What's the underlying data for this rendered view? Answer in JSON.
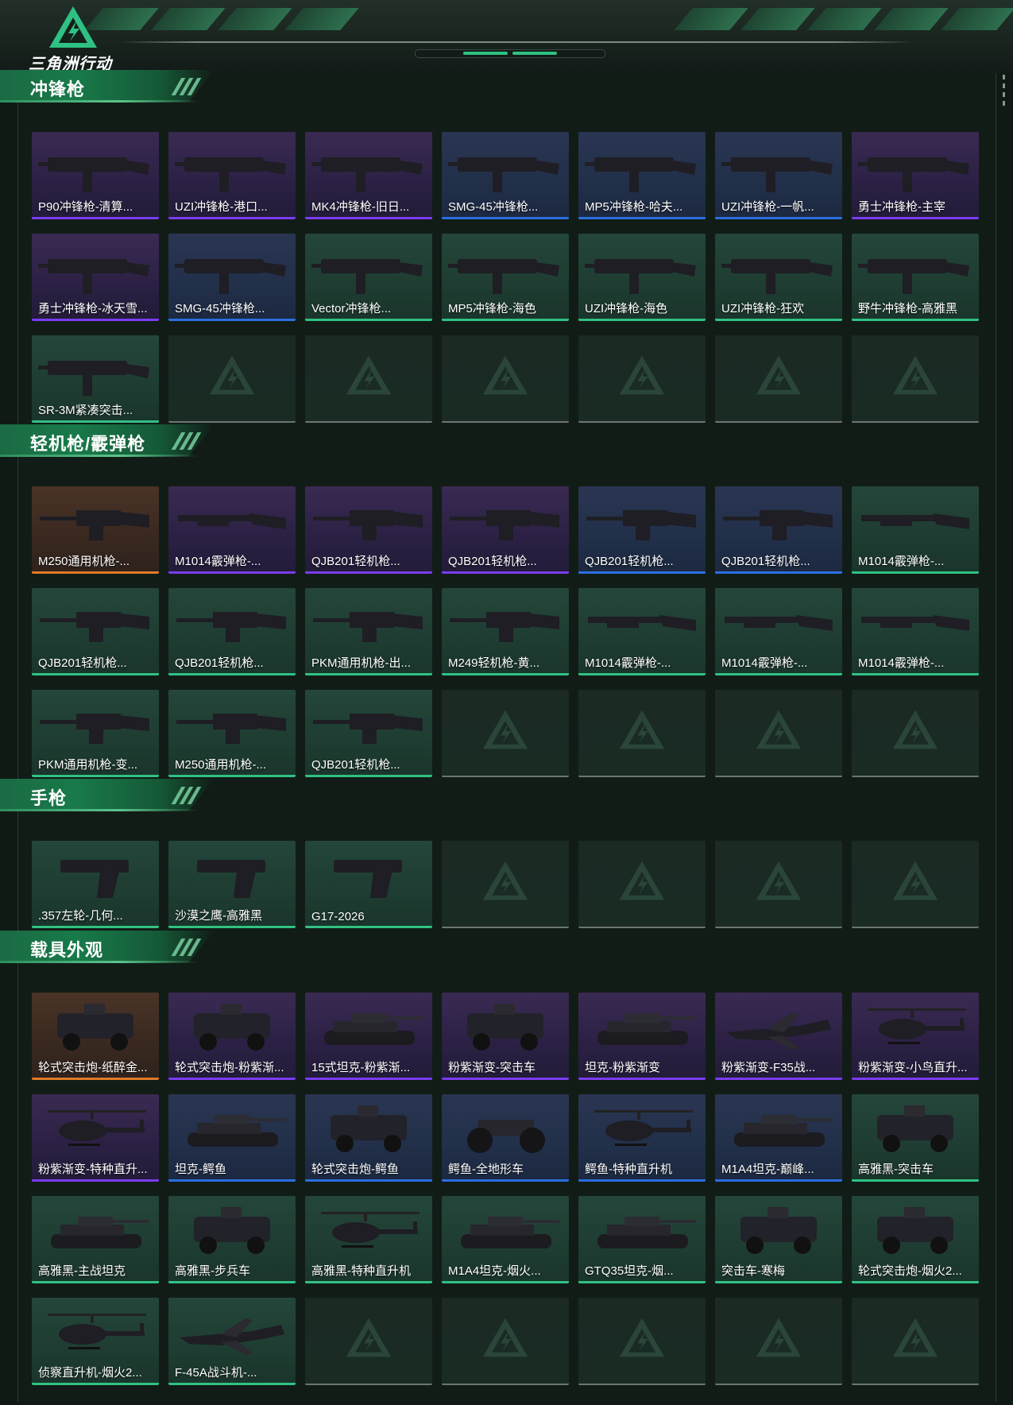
{
  "header": {
    "logo_text": "三角洲行动",
    "logo_icon": "delta-triangle-logo-icon"
  },
  "colors": {
    "purple": "#7a3cf0",
    "blue": "#2b6fe0",
    "green": "#2fc183",
    "orange": "#e07a25",
    "empty": "#6d7672",
    "accent": "#2fc183"
  },
  "sections": [
    {
      "title": "冲锋枪",
      "items": [
        {
          "label": "P90冲锋枪-清算...",
          "rarity": "purple",
          "icon": "smg-icon"
        },
        {
          "label": "UZI冲锋枪-港口...",
          "rarity": "purple",
          "icon": "smg-icon"
        },
        {
          "label": "MK4冲锋枪-旧日...",
          "rarity": "purple",
          "icon": "smg-icon"
        },
        {
          "label": "SMG-45冲锋枪...",
          "rarity": "blue",
          "icon": "smg-icon"
        },
        {
          "label": "MP5冲锋枪-哈夫...",
          "rarity": "blue",
          "icon": "smg-icon"
        },
        {
          "label": "UZI冲锋枪-一帆...",
          "rarity": "blue",
          "icon": "smg-icon"
        },
        {
          "label": "勇士冲锋枪-主宰",
          "rarity": "purple",
          "icon": "smg-icon"
        },
        {
          "label": "勇士冲锋枪-冰天雪...",
          "rarity": "purple",
          "icon": "smg-icon"
        },
        {
          "label": "SMG-45冲锋枪...",
          "rarity": "blue",
          "icon": "smg-icon"
        },
        {
          "label": "Vector冲锋枪...",
          "rarity": "green",
          "icon": "smg-icon"
        },
        {
          "label": "MP5冲锋枪-海色",
          "rarity": "green",
          "icon": "smg-icon"
        },
        {
          "label": "UZI冲锋枪-海色",
          "rarity": "green",
          "icon": "smg-icon"
        },
        {
          "label": "UZI冲锋枪-狂欢",
          "rarity": "green",
          "icon": "smg-icon"
        },
        {
          "label": "野牛冲锋枪-高雅黑",
          "rarity": "green",
          "icon": "smg-icon"
        },
        {
          "label": "SR-3M紧凑突击...",
          "rarity": "green",
          "icon": "smg-icon"
        }
      ],
      "empty_slots": 6
    },
    {
      "title": "轻机枪/霰弹枪",
      "items": [
        {
          "label": "M250通用机枪-...",
          "rarity": "orange",
          "icon": "lmg-icon"
        },
        {
          "label": "M1014霰弹枪-...",
          "rarity": "purple",
          "icon": "shotgun-icon"
        },
        {
          "label": "QJB201轻机枪...",
          "rarity": "purple",
          "icon": "lmg-icon"
        },
        {
          "label": "QJB201轻机枪...",
          "rarity": "purple",
          "icon": "lmg-icon"
        },
        {
          "label": "QJB201轻机枪...",
          "rarity": "blue",
          "icon": "lmg-icon"
        },
        {
          "label": "QJB201轻机枪...",
          "rarity": "blue",
          "icon": "lmg-icon"
        },
        {
          "label": "M1014霰弹枪-...",
          "rarity": "green",
          "icon": "shotgun-icon"
        },
        {
          "label": "QJB201轻机枪...",
          "rarity": "green",
          "icon": "lmg-icon"
        },
        {
          "label": "QJB201轻机枪...",
          "rarity": "green",
          "icon": "lmg-icon"
        },
        {
          "label": "PKM通用机枪-出...",
          "rarity": "green",
          "icon": "lmg-icon"
        },
        {
          "label": "M249轻机枪-黄...",
          "rarity": "green",
          "icon": "lmg-icon"
        },
        {
          "label": "M1014霰弹枪-...",
          "rarity": "green",
          "icon": "shotgun-icon"
        },
        {
          "label": "M1014霰弹枪-...",
          "rarity": "green",
          "icon": "shotgun-icon"
        },
        {
          "label": "M1014霰弹枪-...",
          "rarity": "green",
          "icon": "shotgun-icon"
        },
        {
          "label": "PKM通用机枪-变...",
          "rarity": "green",
          "icon": "lmg-icon"
        },
        {
          "label": "M250通用机枪-...",
          "rarity": "green",
          "icon": "lmg-icon"
        },
        {
          "label": "QJB201轻机枪...",
          "rarity": "green",
          "icon": "lmg-icon"
        }
      ],
      "empty_slots": 4
    },
    {
      "title": "手枪",
      "items": [
        {
          "label": ".357左轮-几何...",
          "rarity": "green",
          "icon": "revolver-icon"
        },
        {
          "label": "沙漠之鹰-高雅黑",
          "rarity": "green",
          "icon": "pistol-icon"
        },
        {
          "label": "G17-2026",
          "rarity": "green",
          "icon": "pistol-icon"
        }
      ],
      "empty_slots": 4
    },
    {
      "title": "载具外观",
      "items": [
        {
          "label": "轮式突击炮-纸醉金...",
          "rarity": "orange",
          "icon": "armored-car-icon"
        },
        {
          "label": "轮式突击炮-粉紫渐...",
          "rarity": "purple",
          "icon": "armored-car-icon"
        },
        {
          "label": "15式坦克-粉紫渐...",
          "rarity": "purple",
          "icon": "tank-icon"
        },
        {
          "label": "粉紫渐变-突击车",
          "rarity": "purple",
          "icon": "armored-car-icon"
        },
        {
          "label": "坦克-粉紫渐变",
          "rarity": "purple",
          "icon": "tank-icon"
        },
        {
          "label": "粉紫渐变-F35战...",
          "rarity": "purple",
          "icon": "jet-icon"
        },
        {
          "label": "粉紫渐变-小鸟直升...",
          "rarity": "purple",
          "icon": "helicopter-icon"
        },
        {
          "label": "粉紫渐变-特种直升...",
          "rarity": "purple",
          "icon": "helicopter-icon"
        },
        {
          "label": "坦克-鳄鱼",
          "rarity": "blue",
          "icon": "tank-icon"
        },
        {
          "label": "轮式突击炮-鳄鱼",
          "rarity": "blue",
          "icon": "armored-car-icon"
        },
        {
          "label": "鳄鱼-全地形车",
          "rarity": "blue",
          "icon": "atv-icon"
        },
        {
          "label": "鳄鱼-特种直升机",
          "rarity": "blue",
          "icon": "helicopter-icon"
        },
        {
          "label": "M1A4坦克-巅峰...",
          "rarity": "blue",
          "icon": "tank-icon"
        },
        {
          "label": "高雅黑-突击车",
          "rarity": "green",
          "icon": "armored-car-icon"
        },
        {
          "label": "高雅黑-主战坦克",
          "rarity": "green",
          "icon": "tank-icon"
        },
        {
          "label": "高雅黑-步兵车",
          "rarity": "green",
          "icon": "armored-car-icon"
        },
        {
          "label": "高雅黑-特种直升机",
          "rarity": "green",
          "icon": "helicopter-icon"
        },
        {
          "label": "M1A4坦克-烟火...",
          "rarity": "green",
          "icon": "tank-icon"
        },
        {
          "label": "GTQ35坦克-烟...",
          "rarity": "green",
          "icon": "tank-icon"
        },
        {
          "label": "突击车-寒梅",
          "rarity": "green",
          "icon": "armored-car-icon"
        },
        {
          "label": "轮式突击炮-烟火2...",
          "rarity": "green",
          "icon": "armored-car-icon"
        },
        {
          "label": "侦察直升机-烟火2...",
          "rarity": "green",
          "icon": "helicopter-icon"
        },
        {
          "label": "F-45A战斗机-...",
          "rarity": "green",
          "icon": "jet-icon"
        }
      ],
      "empty_slots": 5
    }
  ]
}
